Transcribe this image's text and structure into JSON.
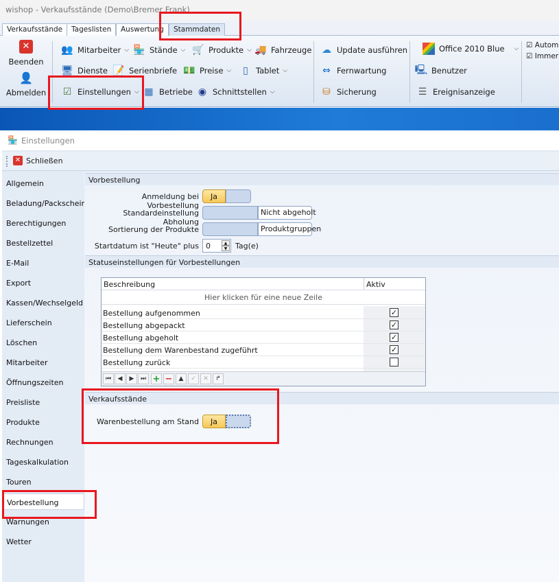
{
  "app": {
    "title": "wishop - Verkaufsstände (Demo\\Bremer,Frank)"
  },
  "tabs": [
    "Verkaufsstände",
    "Tageslisten",
    "Auswertung",
    "Stammdaten"
  ],
  "ribbon": {
    "beenden": "Beenden",
    "abmelden": "Abmelden",
    "mitarbeiter": "Mitarbeiter",
    "staende": "Stände",
    "produkte": "Produkte",
    "fahrzeuge": "Fahrzeuge",
    "dienste": "Dienste",
    "serienbriefe": "Serienbriefe",
    "preise": "Preise",
    "tablet": "Tablet",
    "einstellungen": "Einstellungen",
    "betriebe": "Betriebe",
    "schnittstellen": "Schnittstellen",
    "update": "Update ausführen",
    "fernwartung": "Fernwartung",
    "sicherung": "Sicherung",
    "theme": "Office 2010 Blue",
    "benutzer": "Benutzer",
    "ereignisanzeige": "Ereignisanzeige",
    "check1": "Automa",
    "check2": "Immer i"
  },
  "window": {
    "title": "Einstellungen",
    "close": "Schließen"
  },
  "nav": [
    "Allgemein",
    "Beladung/Packschein",
    "Berechtigungen",
    "Bestellzettel",
    "E-Mail",
    "Export",
    "Kassen/Wechselgeld",
    "Lieferschein",
    "Löschen",
    "Mitarbeiter",
    "Öffnungszeiten",
    "Preisliste",
    "Produkte",
    "Rechnungen",
    "Tageskalkulation",
    "Touren",
    "Vorbestellung",
    "Warnungen",
    "Wetter"
  ],
  "nav_selected": "Vorbestellung",
  "vorbestellung": {
    "header": "Vorbestellung",
    "anmeldung_label": "Anmeldung bei Vorbestellung",
    "anmeldung_value": "Ja",
    "abholung_label": "Standardeinstellung Abholung",
    "abholung_value": "Nicht abgeholt",
    "sortierung_label": "Sortierung der Produkte",
    "sortierung_value": "Produktgruppen",
    "startdatum_label": "Startdatum ist \"Heute\" plus",
    "startdatum_value": "0",
    "startdatum_unit": "Tag(e)"
  },
  "status": {
    "header": "Statuseinstellungen für Vorbestellungen",
    "col_desc": "Beschreibung",
    "col_active": "Aktiv",
    "new_row": "Hier klicken für eine neue Zeile",
    "rows": [
      {
        "desc": "Bestellung aufgenommen",
        "active": true
      },
      {
        "desc": "Bestellung abgepackt",
        "active": true
      },
      {
        "desc": "Bestellung abgeholt",
        "active": true
      },
      {
        "desc": "Bestellung dem Warenbestand zugeführt",
        "active": true
      },
      {
        "desc": "Bestellung zurück",
        "active": false
      }
    ]
  },
  "verkaufsstaende": {
    "header": "Verkaufsstände",
    "label": "Warenbestellung am Stand",
    "value": "Ja"
  },
  "colors": {
    "highlight": "#e8171f",
    "accent": "#1f6fce",
    "toggle_on": "#f7c858"
  }
}
